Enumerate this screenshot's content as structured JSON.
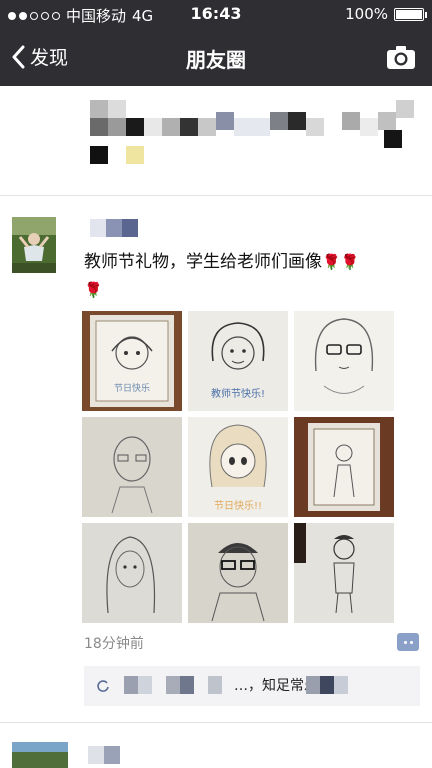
{
  "status_bar": {
    "carrier": "中国移动",
    "network": "4G",
    "time": "16:43",
    "battery": "100%",
    "battery_level": 1.0
  },
  "nav": {
    "back_label": "发现",
    "title": "朋友圈",
    "camera_icon": "camera-icon"
  },
  "post": {
    "text": "教师节礼物，学生给老师们画像",
    "flower_emoji": "🌹",
    "photo_count": 9,
    "time_ago": "18分钟前",
    "comment_icon": "comment-dots-icon",
    "comment_preview": "…，知足常乐…"
  },
  "colors": {
    "nav_background": "#2e2e33",
    "link_blue": "#576b95",
    "comment_box": "#f3f3f5"
  }
}
